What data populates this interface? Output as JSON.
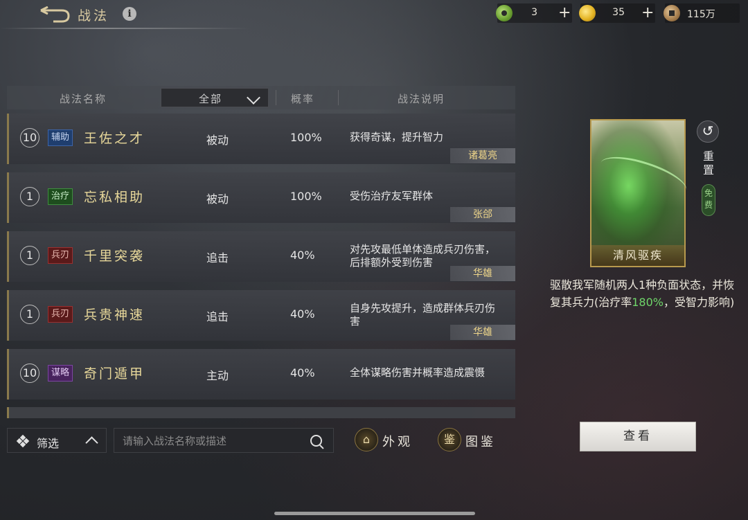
{
  "header": {
    "title": "战法"
  },
  "resources": [
    {
      "icon": "jade-coin-icon",
      "value": "3"
    },
    {
      "icon": "gold-coin-icon",
      "value": "35"
    },
    {
      "icon": "copper-coin-icon",
      "value": "115万"
    }
  ],
  "table": {
    "headers": {
      "name": "战法名称",
      "filter": "全部",
      "rate": "概率",
      "desc": "战法说明"
    },
    "rows": [
      {
        "level": "10",
        "tag": "辅助",
        "name": "王佐之才",
        "type": "被动",
        "rate": "100%",
        "desc": "获得奇谋，提升智力",
        "owner": "诸葛亮"
      },
      {
        "level": "1",
        "tag": "治疗",
        "name": "忘私相助",
        "type": "被动",
        "rate": "100%",
        "desc": "受伤治疗友军群体",
        "owner": "张郃"
      },
      {
        "level": "1",
        "tag": "兵刃",
        "name": "千里突袭",
        "type": "追击",
        "rate": "40%",
        "desc": "对先攻最低单体造成兵刃伤害，后排额外受到伤害",
        "owner": "华雄"
      },
      {
        "level": "1",
        "tag": "兵刃",
        "name": "兵贵神速",
        "type": "追击",
        "rate": "40%",
        "desc": "自身先攻提升，造成群体兵刃伤害",
        "owner": "华雄"
      },
      {
        "level": "10",
        "tag": "谋略",
        "name": "奇门遁甲",
        "type": "主动",
        "rate": "40%",
        "desc": "全体谋略伤害并概率造成震慑",
        "owner": ""
      }
    ]
  },
  "toolbar": {
    "filter_label": "筛选",
    "search_placeholder": "请输入战法名称或描述",
    "appearance_label": "外观",
    "appearance_icon_glyph": "⌂",
    "codex_label": "图鉴",
    "codex_icon_glyph": "鉴"
  },
  "detail": {
    "card_name": "清风驱疾",
    "reset_label": "重置",
    "free_label": "免费",
    "desc_pre": "驱散我军随机两人1种负面状态，并恢复其兵力(治疗率",
    "desc_highlight": "180%",
    "desc_post": "，受智力影响)",
    "view_button": "查看"
  },
  "colors": {
    "highlight_green": "#6fd66a",
    "owner_gold": "#f0d78a",
    "name_gold": "#e8d89a",
    "tag_auxiliary": "#1f3e6e",
    "tag_heal": "#1e4d1e",
    "tag_weapon": "#5a1a1a",
    "tag_strategy": "#48235e"
  }
}
